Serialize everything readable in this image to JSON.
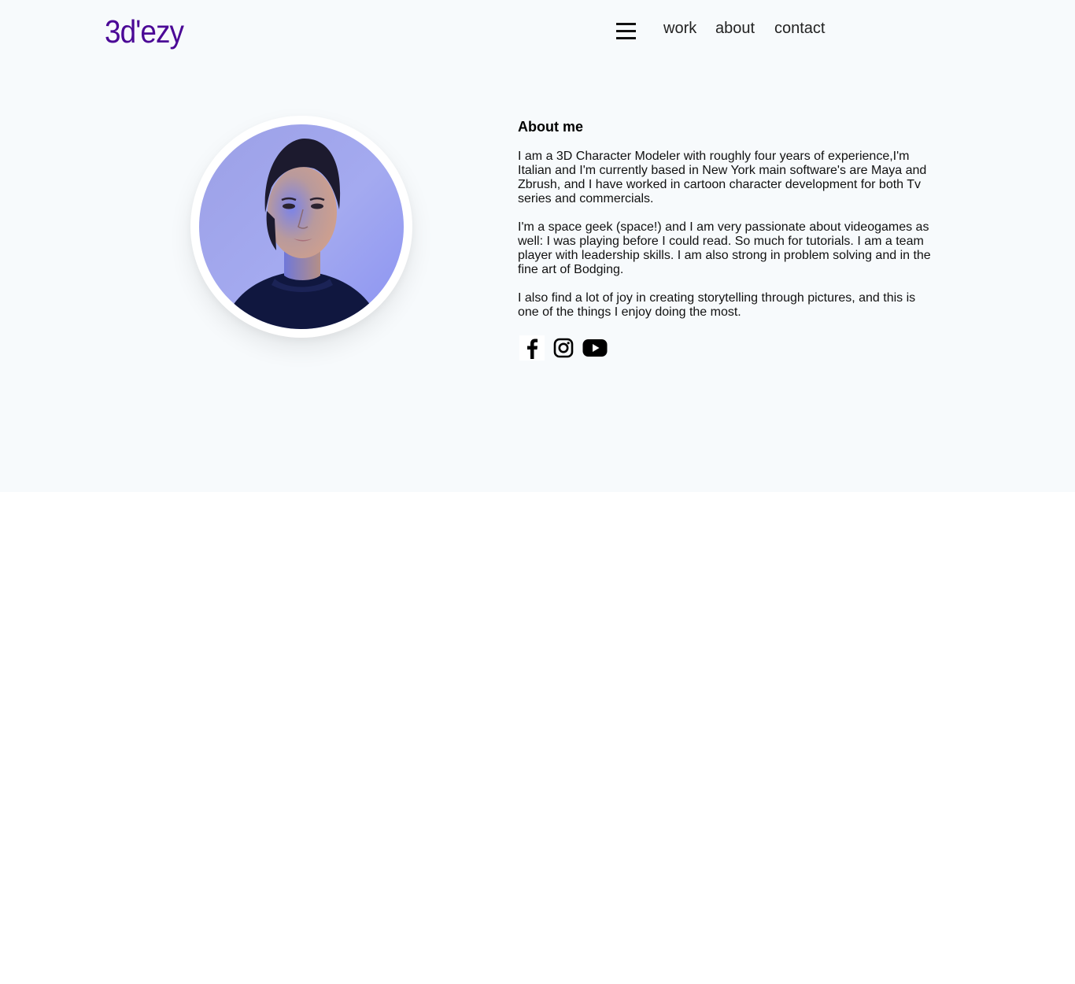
{
  "header": {
    "logo": "3d'ezy",
    "menu_icon": "hamburger-menu-icon",
    "nav": [
      "work",
      "about",
      "contact"
    ]
  },
  "about": {
    "title": "About me",
    "paragraphs": [
      "I am a 3D Character Modeler with roughly four years of experience,I'm Italian and I'm currently based in New York main software's are Maya and Zbrush, and I have worked in cartoon character development for both Tv series and commercials.",
      "I'm a space geek (space!) and I am very passionate about videogames as well: I was playing before I could read. So much for tutorials. I am a team player with leadership skills. I am also strong in problem solving and in the fine art of Bodging.",
      "I also find a lot of joy in creating storytelling through pictures, and this is one of the things I enjoy doing the most."
    ]
  },
  "social": [
    "facebook-icon",
    "instagram-icon",
    "youtube-icon"
  ],
  "colors": {
    "logo": "#4b0896",
    "hero_background": "#f7fafc",
    "page_background": "#ffffff"
  }
}
